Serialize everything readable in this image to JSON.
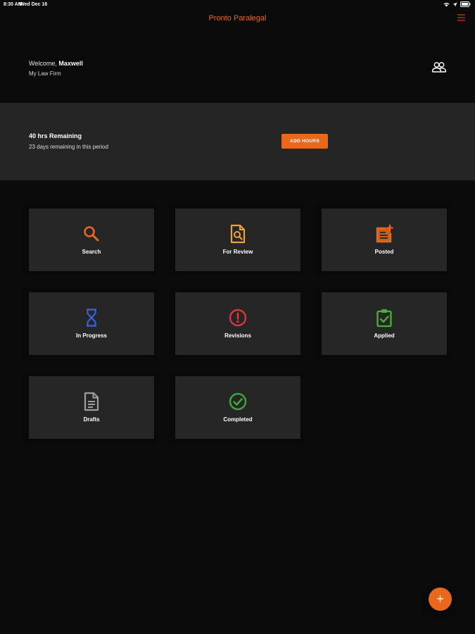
{
  "status_bar": {
    "time": "8:30 AM",
    "date": "Wed Dec 16"
  },
  "header": {
    "title": "Pronto Paralegal",
    "menu_icon": "hamburger-menu-icon"
  },
  "welcome": {
    "prefix": "Welcome, ",
    "name": "Maxwell",
    "firm": "My Law Firm",
    "users_icon": "users-icon"
  },
  "hours": {
    "title": "40 hrs Remaining",
    "subtitle": "23 days remaining in this period",
    "button_label": "ADD HOURS"
  },
  "tiles": [
    {
      "label": "Search",
      "icon": "search-icon",
      "color": "#e8681e"
    },
    {
      "label": "For Review",
      "icon": "document-search-icon",
      "color": "#e8a33a"
    },
    {
      "label": "Posted",
      "icon": "post-add-icon",
      "color": "#e8681e"
    },
    {
      "label": "In Progress",
      "icon": "hourglass-icon",
      "color": "#3a5fd9"
    },
    {
      "label": "Revisions",
      "icon": "alert-circle-icon",
      "color": "#d9363e"
    },
    {
      "label": "Applied",
      "icon": "clipboard-check-icon",
      "color": "#4caf3a"
    },
    {
      "label": "Drafts",
      "icon": "document-icon",
      "color": "#9e9e9e"
    },
    {
      "label": "Completed",
      "icon": "check-circle-icon",
      "color": "#3aa83a"
    }
  ],
  "fab": {
    "label": "+",
    "icon": "plus-icon"
  },
  "colors": {
    "accent": "#e8681e",
    "background": "#0a0a0a",
    "panel": "#252525",
    "tile": "#262626"
  }
}
